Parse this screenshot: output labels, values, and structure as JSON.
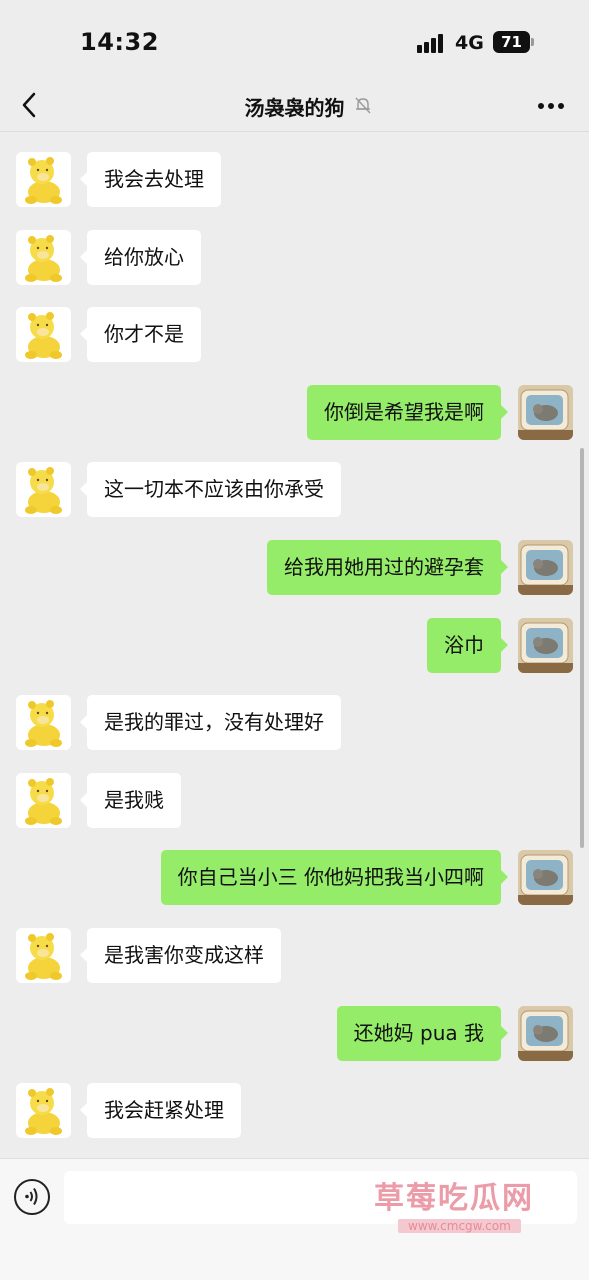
{
  "status_bar": {
    "time": "14:32",
    "network": "4G",
    "battery": "71"
  },
  "header": {
    "back_icon": "chevron-left-icon",
    "title": "汤袅袅的狗",
    "mute_icon": "bell-muted-icon",
    "more_icon": "more-dots-icon"
  },
  "messages": [
    {
      "side": "in",
      "text": "我会去处理"
    },
    {
      "side": "in",
      "text": "给你放心"
    },
    {
      "side": "in",
      "text": "你才不是"
    },
    {
      "side": "out",
      "text": "你倒是希望我是啊"
    },
    {
      "side": "in",
      "text": "这一切本不应该由你承受"
    },
    {
      "side": "out",
      "text": "给我用她用过的避孕套"
    },
    {
      "side": "out",
      "text": "浴巾"
    },
    {
      "side": "in",
      "text": "是我的罪过，没有处理好"
    },
    {
      "side": "in",
      "text": "是我贱"
    },
    {
      "side": "out",
      "text": "你自己当小三 你他妈把我当小四啊"
    },
    {
      "side": "in",
      "text": "是我害你变成这样"
    },
    {
      "side": "out",
      "text": "还她妈 pua 我"
    },
    {
      "side": "in",
      "text": "我会赶紧处理"
    }
  ],
  "input_bar": {
    "voice_icon": "voice-icon",
    "input_value": ""
  },
  "watermark": {
    "title": "草莓吃瓜网",
    "url": "www.cmcgw.com"
  },
  "colors": {
    "background": "#ededed",
    "incoming_bubble": "#ffffff",
    "outgoing_bubble": "#95ec69"
  }
}
